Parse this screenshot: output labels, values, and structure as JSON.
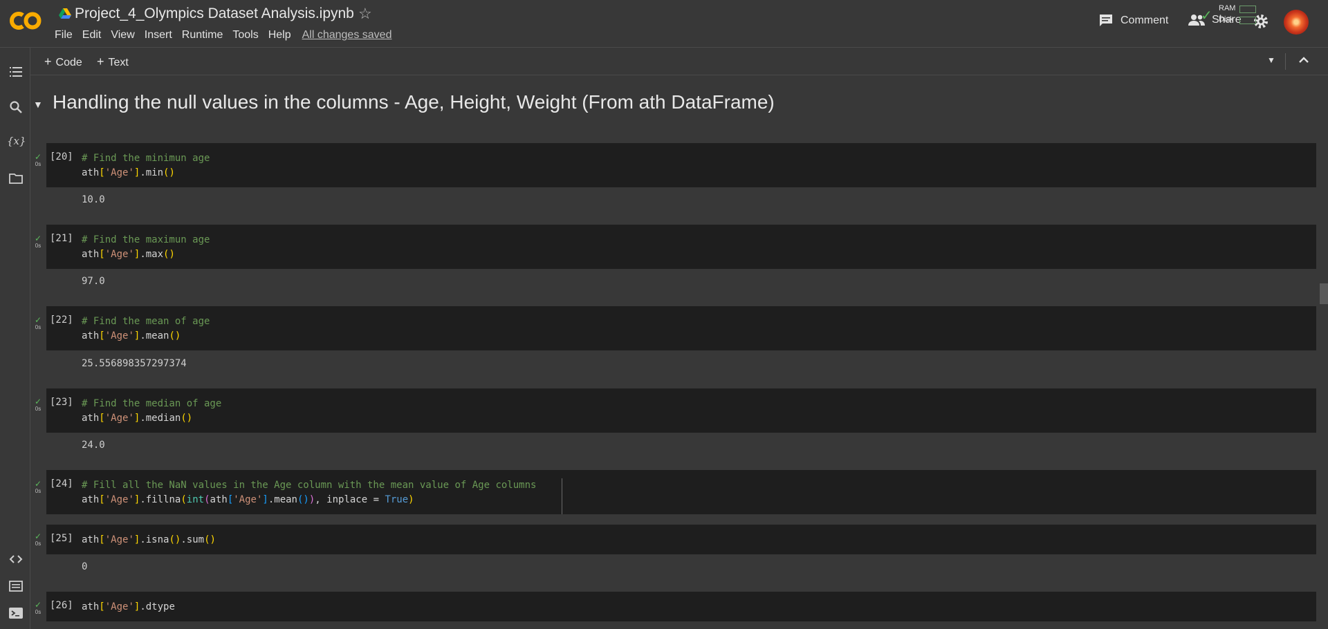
{
  "header": {
    "title": "Project_4_Olympics Dataset Analysis.ipynb",
    "menu": [
      "File",
      "Edit",
      "View",
      "Insert",
      "Runtime",
      "Tools",
      "Help"
    ],
    "saved_status": "All changes saved",
    "comment_label": "Comment",
    "share_label": "Share"
  },
  "toolbar": {
    "add_code": "Code",
    "add_text": "Text",
    "ram_label": "RAM",
    "disk_label": "Disk"
  },
  "section": {
    "title": "Handling the null values in the columns - Age, Height, Weight (From ath DataFrame)"
  },
  "cells": [
    {
      "count": "[20]",
      "time": "0s",
      "output": "10.0"
    },
    {
      "count": "[21]",
      "time": "0s",
      "output": "97.0"
    },
    {
      "count": "[22]",
      "time": "0s",
      "output": "25.556898357297374"
    },
    {
      "count": "[23]",
      "time": "0s",
      "output": "24.0"
    },
    {
      "count": "[24]",
      "time": "0s"
    },
    {
      "count": "[25]",
      "time": "0s",
      "output": "0"
    },
    {
      "count": "[26]",
      "time": "0s"
    }
  ],
  "code": {
    "c20_l1": "# Find the minimun age",
    "c21_l1": "# Find the maximun age",
    "c22_l1": "# Find the mean of age",
    "c23_l1": "# Find the median of age",
    "c24_l1": "# Fill all the NaN values in the Age column with the mean value of Age columns",
    "ath": "ath",
    "age_str": "'Age'",
    "min": ".min",
    "max": ".max",
    "mean": ".mean",
    "median": ".median",
    "fillna": ".fillna",
    "int": "int",
    "isna": ".isna",
    "sum": ".sum",
    "dtype": ".dtype",
    "inplace": ", inplace = ",
    "true": "True"
  },
  "colors": {
    "background": "#383838",
    "cell_bg": "#1e1e1e",
    "success": "#5cb85c",
    "comment": "#6a9955",
    "string": "#ce9178",
    "keyword": "#569cd6"
  }
}
